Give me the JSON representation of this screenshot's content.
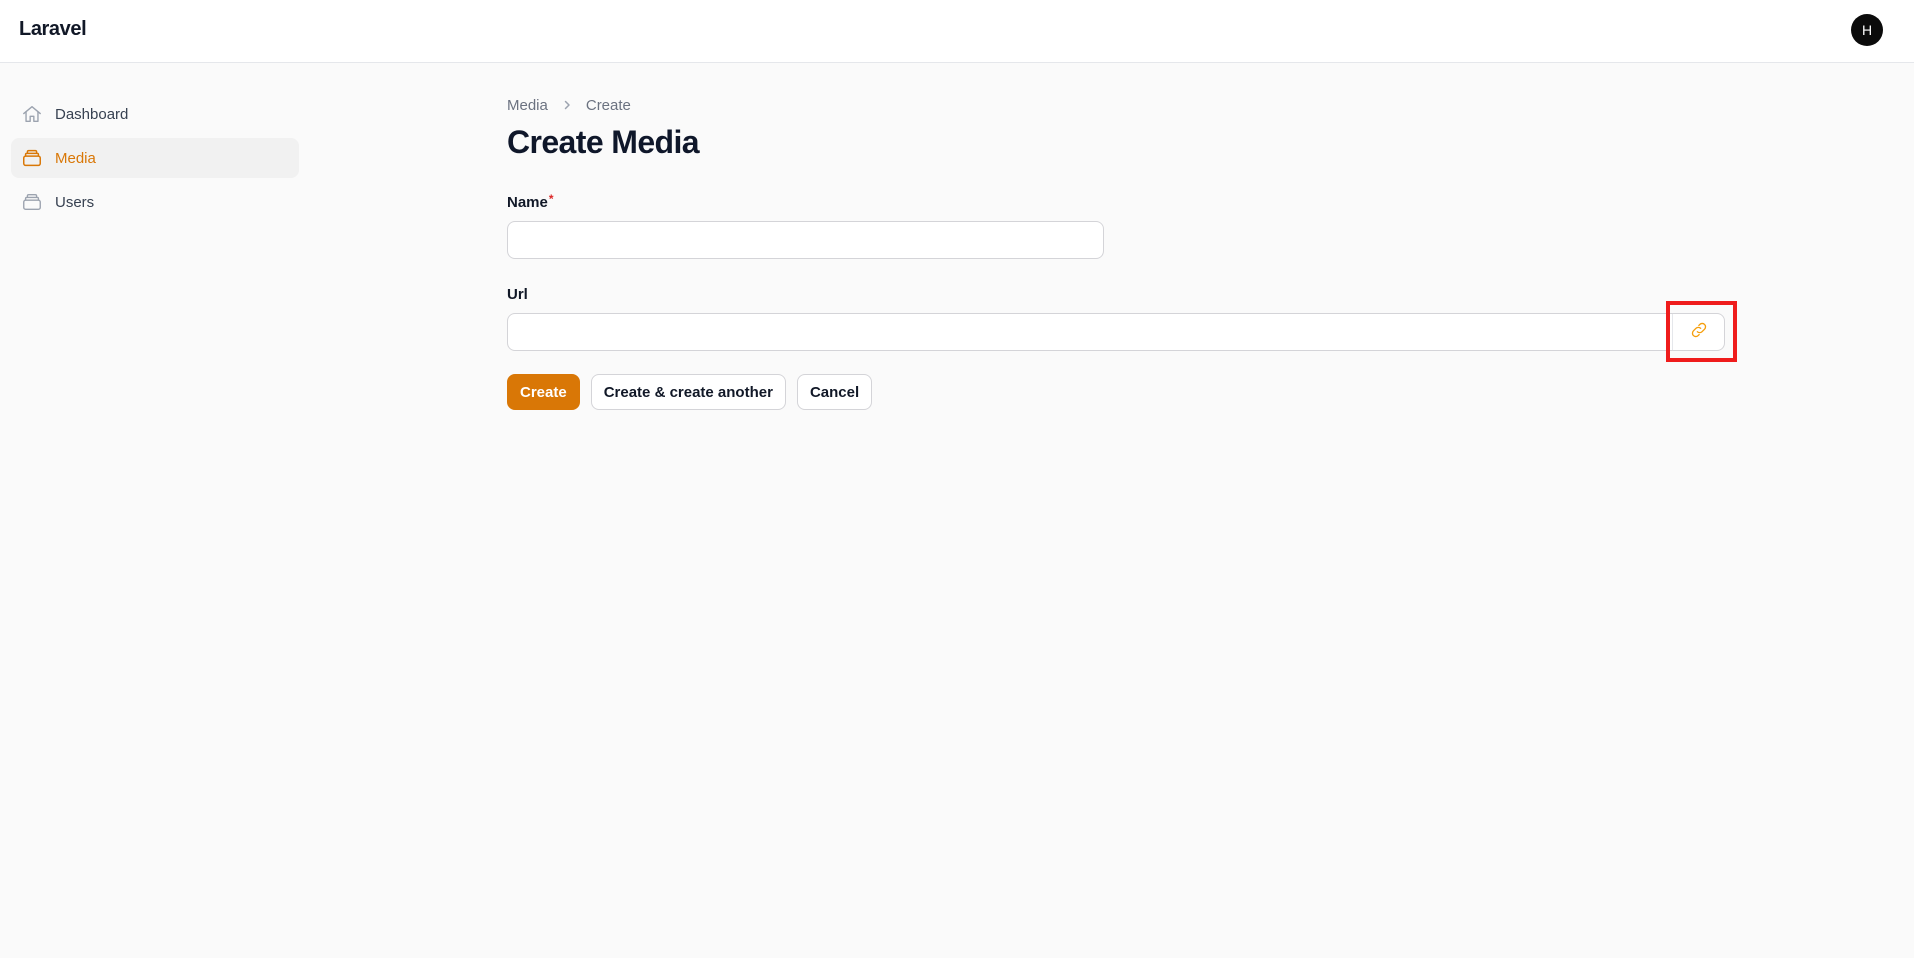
{
  "app": {
    "brand": "Laravel",
    "user_initial": "H"
  },
  "sidebar": {
    "items": [
      {
        "label": "Dashboard",
        "icon": "home-icon",
        "active": false
      },
      {
        "label": "Media",
        "icon": "stack-icon",
        "active": true
      },
      {
        "label": "Users",
        "icon": "stack-icon",
        "active": false
      }
    ]
  },
  "breadcrumb": {
    "items": [
      "Media",
      "Create"
    ]
  },
  "page": {
    "title": "Create Media"
  },
  "form": {
    "name": {
      "label": "Name",
      "required_marker": "*",
      "value": "",
      "placeholder": ""
    },
    "url": {
      "label": "Url",
      "value": "",
      "placeholder": "",
      "suffix_icon": "link-icon"
    }
  },
  "actions": {
    "create": "Create",
    "create_another": "Create & create another",
    "cancel": "Cancel"
  },
  "colors": {
    "accent": "#d97706",
    "required": "#dc2626",
    "highlight": "#ef1c1c",
    "link_icon": "#f59e0b"
  }
}
